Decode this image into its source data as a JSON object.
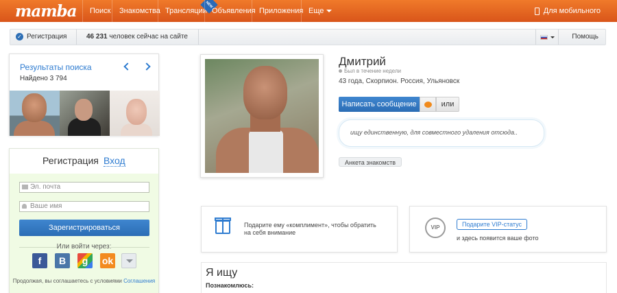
{
  "nav": {
    "logo": "mamba",
    "items": [
      "Поиск",
      "Знакомства",
      "Трансляции",
      "Объявления",
      "Приложения",
      "Еще"
    ],
    "new_badge": "NEW",
    "mobile": "Для мобильного"
  },
  "statusbar": {
    "registration": "Регистрация",
    "online_count": "46 231",
    "online_text": "человек сейчас на сайте",
    "help": "Помощь"
  },
  "search_results": {
    "title": "Результаты поиска",
    "found": "Найдено 3 794"
  },
  "registration": {
    "tab_register": "Регистрация",
    "tab_login": "Вход",
    "email_placeholder": "Эл. почта",
    "name_placeholder": "Ваше имя",
    "submit": "Зарегистрироваться",
    "or_via": "Или войти через:",
    "terms_prefix": "Продолжая, вы соглашаетесь с условиями",
    "terms_link": "Соглашения"
  },
  "profile": {
    "name": "Дмитрий",
    "last_seen": "Был в течение недели",
    "info": "43 года, Скорпион. Россия, Ульяновск",
    "message_button": "Написать сообщение",
    "or": "или",
    "status": "ищу единственную, для совместного удаления отсюда..",
    "anketa": "Анкета знакомств"
  },
  "cards": {
    "gift_text": "Подарите ему «комплимент», чтобы обратить на себя внимание",
    "vip_icon": "VIP",
    "vip_button": "Подарите VIP-статус",
    "vip_text": "и здесь появится ваше фото"
  },
  "looking_for": {
    "title": "Я ищу",
    "subtitle": "Познакомлюсь:"
  },
  "colors": {
    "nav_orange": "#e5641f",
    "link_blue": "#2d7bd0",
    "button_blue": "#3478c0",
    "reg_green_bg": "#f0fbe4"
  }
}
